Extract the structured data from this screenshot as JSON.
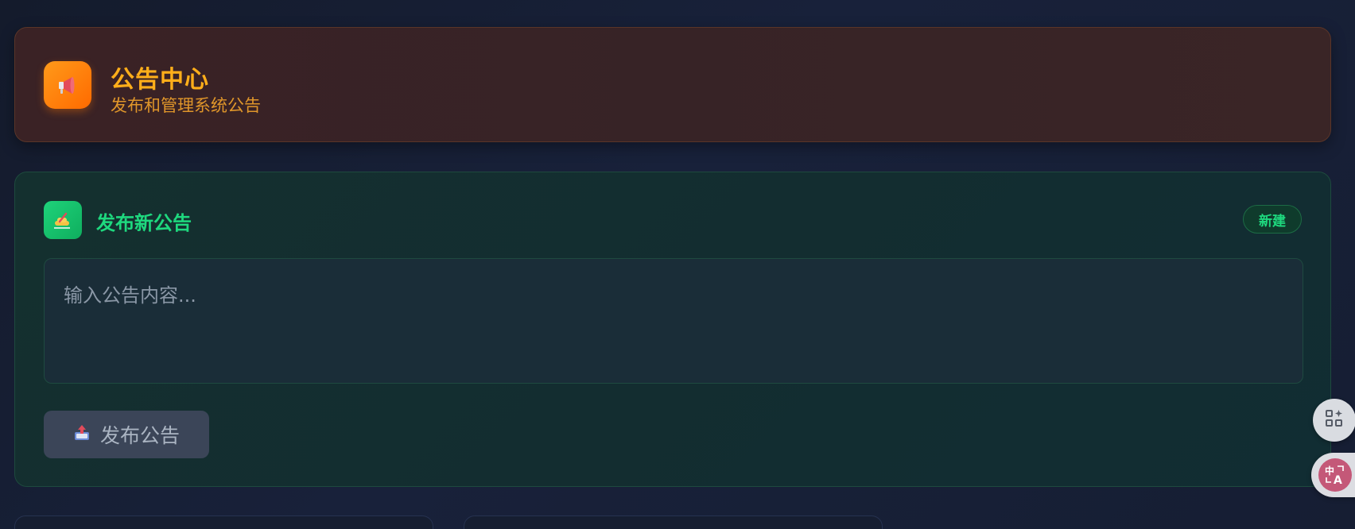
{
  "header": {
    "title": "公告中心",
    "subtitle": "发布和管理系统公告",
    "icon": "megaphone-icon"
  },
  "publish": {
    "title": "发布新公告",
    "icon": "writing-hand-icon",
    "badge": "新建",
    "input_placeholder": "输入公告内容...",
    "input_value": "",
    "button_label": "发布公告",
    "button_icon": "outbox-tray-icon"
  },
  "floating": {
    "apps_icon": "apps-sparkle-icon",
    "translate_icon": "translate-icon"
  },
  "colors": {
    "header_accent": "#ffae1a",
    "publish_accent": "#1ed87e",
    "button_bg": "#3b4558"
  }
}
